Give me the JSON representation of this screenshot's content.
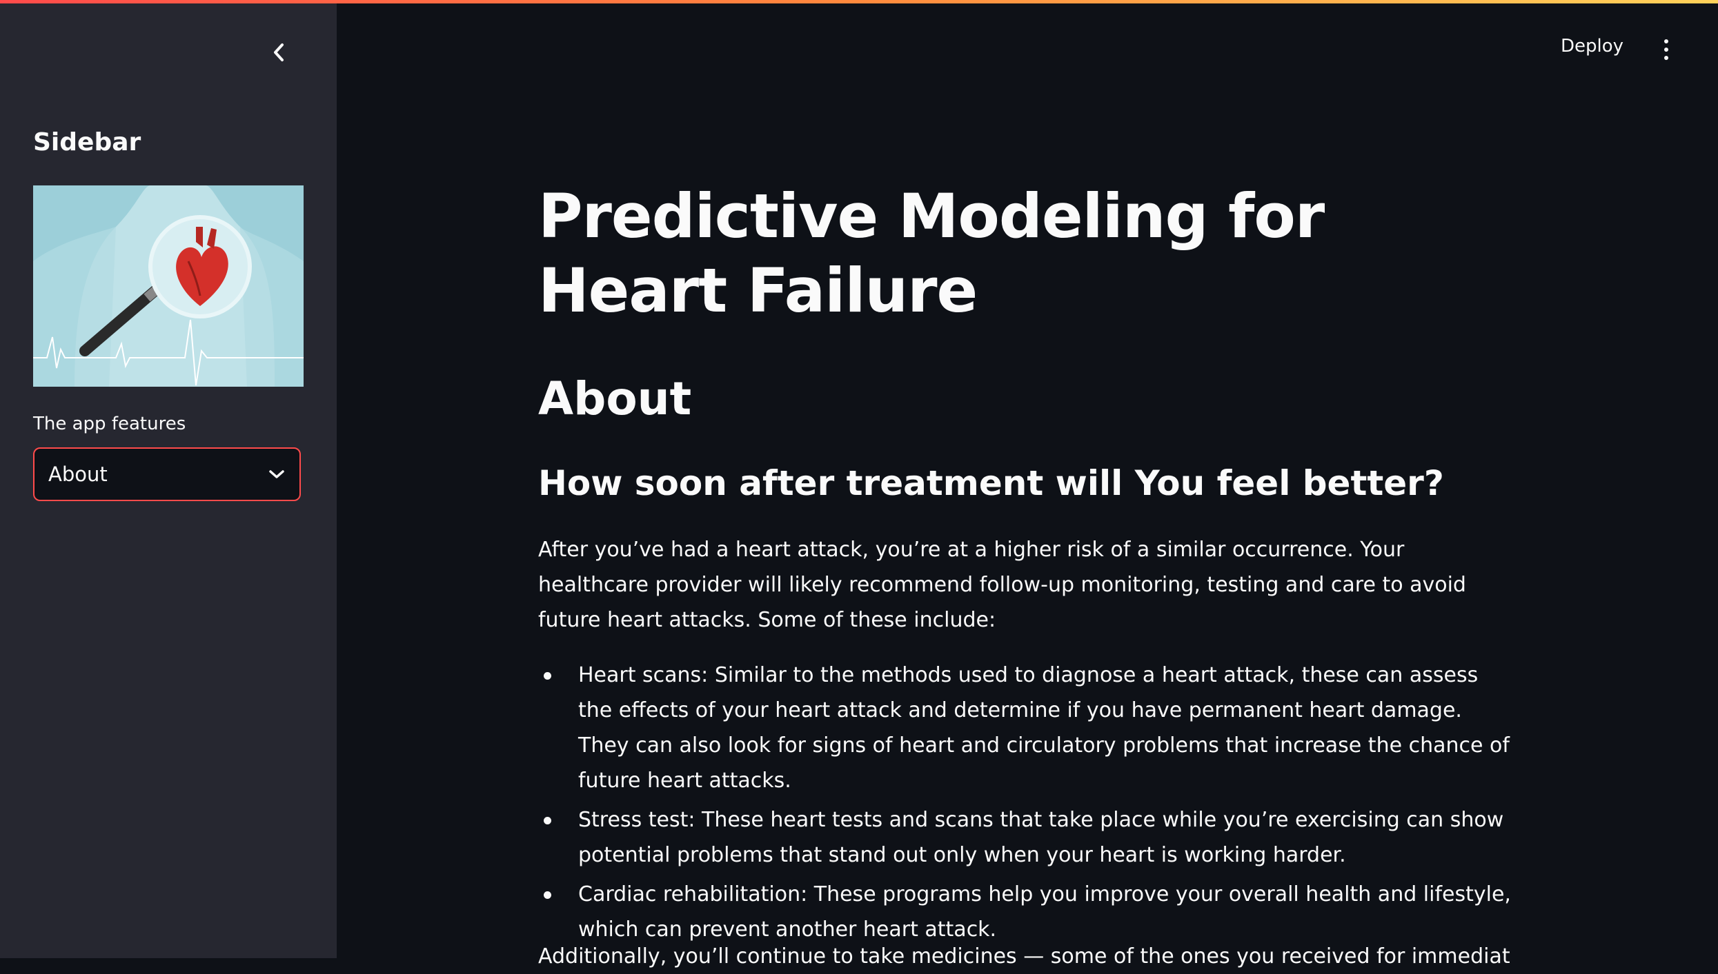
{
  "sidebar": {
    "title": "Sidebar",
    "image_alt": "Illustration of a heart under a magnifying glass with ECG line",
    "select_label": "The app features",
    "select_value": "About",
    "collapse_icon": "chevron-left-icon"
  },
  "header": {
    "deploy_label": "Deploy",
    "menu_icon": "more-vertical-icon"
  },
  "main": {
    "title": "Predictive Modeling for Heart Failure",
    "section_heading": "About",
    "subheading": "How soon after treatment will You feel better?",
    "intro": "After you’ve had a heart attack, you’re at a higher risk of a similar occurrence. Your healthcare provider will likely recommend follow-up monitoring, testing and care to avoid future heart attacks. Some of these include:",
    "bullets": [
      "Heart scans: Similar to the methods used to diagnose a heart attack, these can assess the effects of your heart attack and determine if you have permanent heart damage. They can also look for signs of heart and circulatory problems that increase the chance of future heart attacks.",
      "Stress test: These heart tests and scans that take place while you’re exercising can show potential problems that stand out only when your heart is working harder.",
      "Cardiac rehabilitation: These programs help you improve your overall health and lifestyle, which can prevent another heart attack."
    ],
    "cut_paragraph": "Additionally, you’ll continue to take medicines — some of the ones you received for immediate treatment"
  },
  "colors": {
    "background": "#0e1117",
    "sidebar": "#262730",
    "accent": "#ff4b4b",
    "text": "#fafafa"
  }
}
